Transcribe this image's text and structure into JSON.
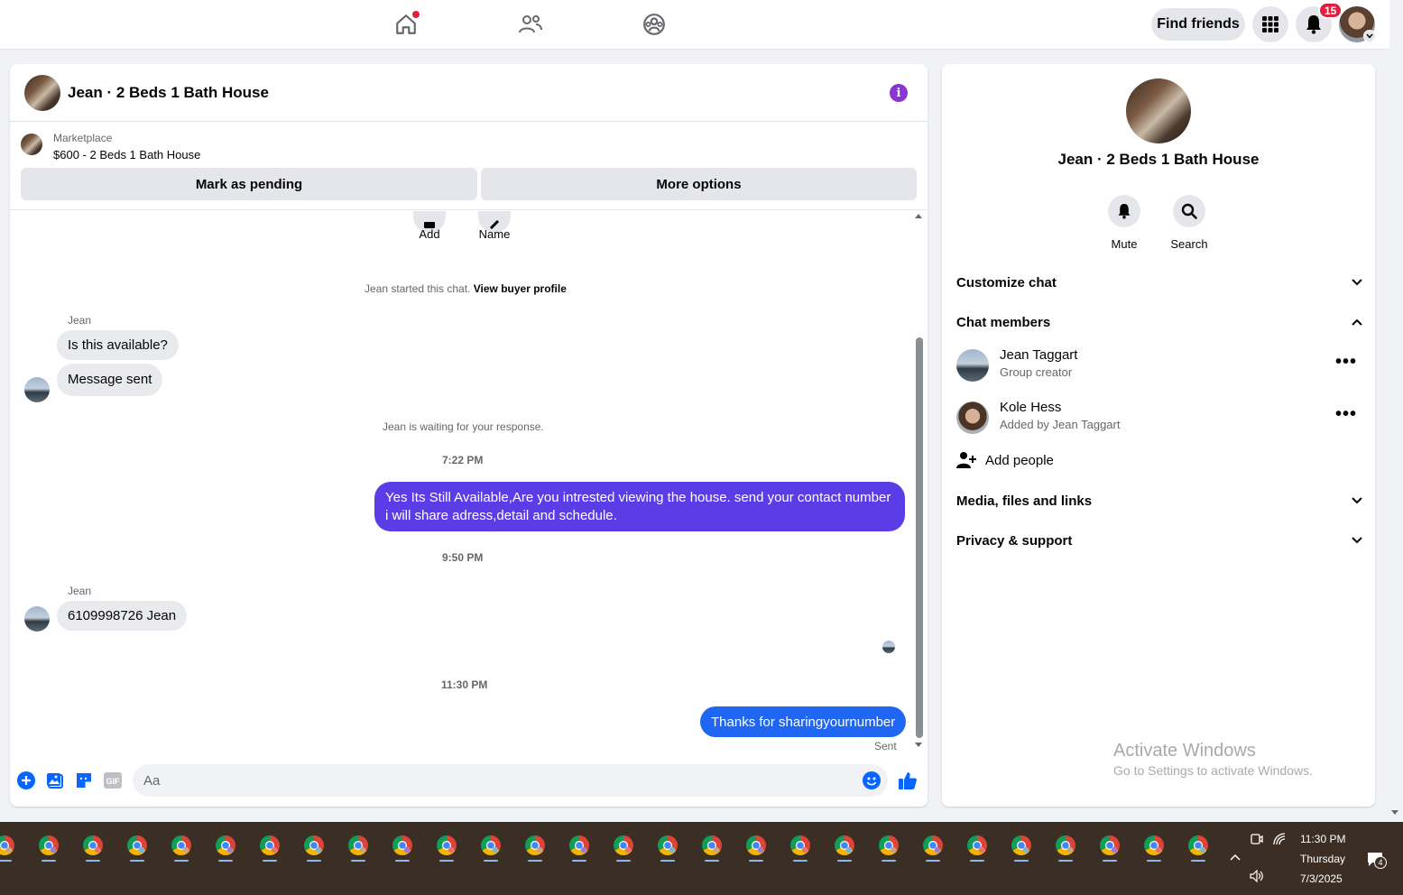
{
  "topbar": {
    "find_friends": "Find friends",
    "notification_count": "15"
  },
  "chat": {
    "title": "Jean · 2 Beds 1 Bath House",
    "marketplace_label": "Marketplace",
    "marketplace_item": "$600 - 2 Beds 1 Bath House",
    "mark_pending": "Mark as pending",
    "more_options": "More options",
    "quick_actions": [
      {
        "label": "Add"
      },
      {
        "label": "Name"
      }
    ],
    "started_text": "Jean started this chat.",
    "view_buyer_profile": "View buyer profile",
    "sender_1": "Jean",
    "msg_1": "Is this available?",
    "msg_2": "Message sent",
    "waiting_text": "Jean is waiting for your response.",
    "time_1": "7:22 PM",
    "msg_3": "Yes Its Still Available,Are you intrested viewing the house. send your contact number i will share adress,detail and schedule.",
    "time_2": "9:50 PM",
    "sender_2": "Jean",
    "msg_4": "6109998726 Jean",
    "time_3": "11:30 PM",
    "msg_5": "Thanks for sharingyournumber",
    "status": "Sent",
    "composer_placeholder": "Aa",
    "colors": {
      "outgoing_purple": "#5b3de8",
      "outgoing_blue": "#1f66f2",
      "accent": "#0866ff"
    }
  },
  "details": {
    "name": "Jean · 2 Beds 1 Bath House",
    "mute": "Mute",
    "search": "Search",
    "customize_chat": "Customize chat",
    "chat_members": "Chat members",
    "members": [
      {
        "name": "Jean Taggart",
        "sub": "Group creator"
      },
      {
        "name": "Kole Hess",
        "sub": "Added by Jean Taggart"
      }
    ],
    "add_people": "Add people",
    "media_files_links": "Media, files and links",
    "privacy_support": "Privacy & support",
    "activate_title": "Activate Windows",
    "activate_sub": "Go to Settings to activate Windows."
  },
  "taskbar": {
    "time": "11:30 PM",
    "day": "Thursday",
    "date": "7/3/2025",
    "notification_count": "4"
  }
}
